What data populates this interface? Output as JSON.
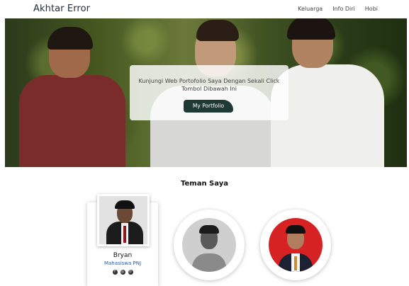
{
  "navbar": {
    "brand": "Akhtar Error",
    "links": [
      "Keluarga",
      "Info Diri",
      "Hobi"
    ]
  },
  "hero": {
    "text": "Kunjungi Web Portofolio Saya Dengan Sekali Click Tombol Dibawah Ini",
    "button_label": "My Portfolio"
  },
  "friends": {
    "title": "Teman Saya",
    "featured": {
      "name": "Bryan",
      "role": "Mahasiswa PNJ",
      "social_icons": [
        "facebook-icon",
        "instagram-icon",
        "whatsapp-icon"
      ]
    }
  },
  "colors": {
    "button_bg": "#1f3a33",
    "role_text": "#2a5aa8",
    "photo_bg_red": "#d62222"
  }
}
